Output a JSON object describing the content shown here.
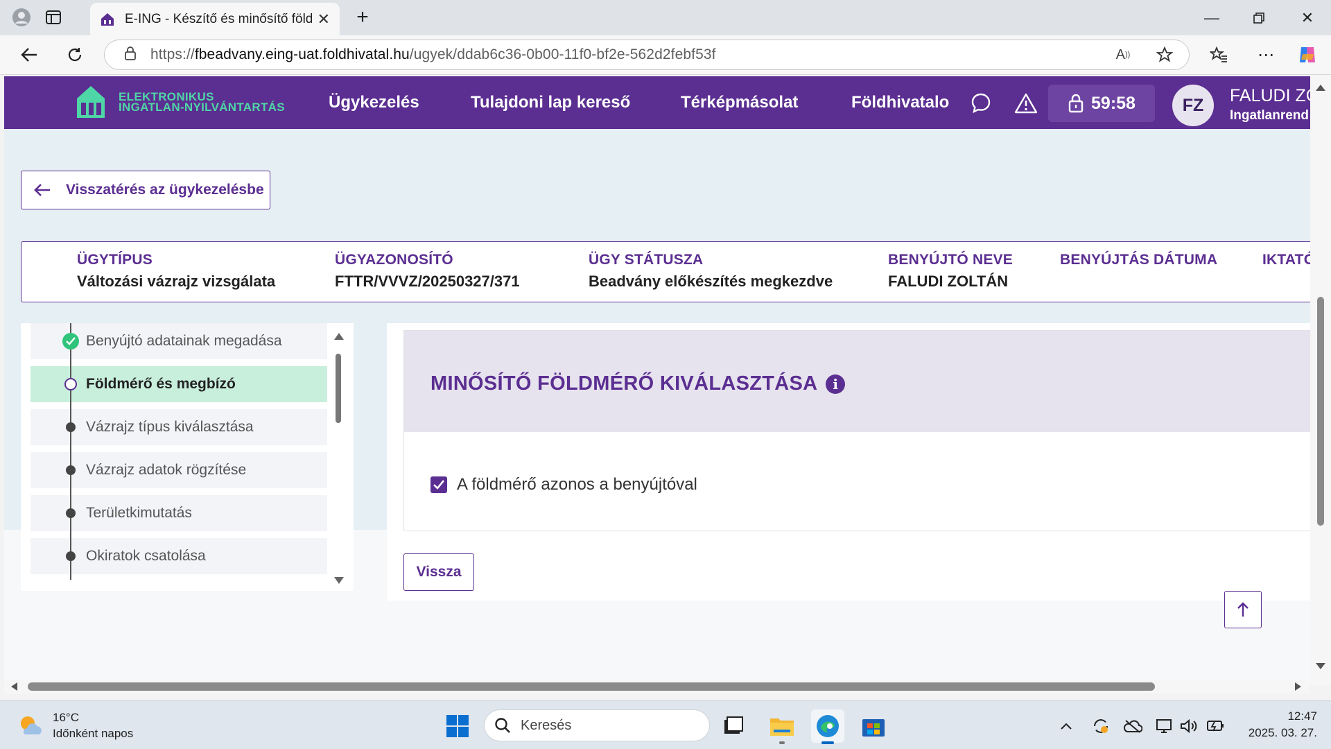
{
  "browser": {
    "tab_title": "E-ING - Készítő és minősítő földm",
    "url_prefix": "https://",
    "url_host": "fbeadvany.eing-uat.foldhivatal.hu",
    "url_path": "/ugyek/ddab6c36-0b00-11f0-bf2e-562d2febf53f"
  },
  "header": {
    "logo_line1": "ELEKTRONIKUS",
    "logo_line2": "INGATLAN-NYILVÁNTARTÁS",
    "menu": [
      "Ügykezelés",
      "Tulajdoni lap kereső",
      "Térképmásolat",
      "Földhivatalo"
    ],
    "timer": "59:58",
    "avatar_initials": "FZ",
    "user_name": "FALUDI ZO",
    "user_role": "Ingatlanrend"
  },
  "back_button": "Visszatérés az ügykezelésbe",
  "case_info": [
    {
      "label": "ÜGYTÍPUS",
      "value": "Változási vázrajz vizsgálata"
    },
    {
      "label": "ÜGYAZONOSÍTÓ",
      "value": "FTTR/VVVZ/20250327/371"
    },
    {
      "label": "ÜGY STÁTUSZA",
      "value": "Beadvány előkészítés megkezdve"
    },
    {
      "label": "BENYÚJTÓ NEVE",
      "value": "FALUDI ZOLTÁN"
    },
    {
      "label": "BENYÚJTÁS DÁTUMA",
      "value": ""
    },
    {
      "label": "IKTATÓ",
      "value": ""
    }
  ],
  "steps": [
    {
      "label": "Benyújtó adatainak megadása",
      "state": "done"
    },
    {
      "label": "Földmérő és megbízó",
      "state": "active"
    },
    {
      "label": "Vázrajz típus kiválasztása",
      "state": "todo"
    },
    {
      "label": "Vázrajz adatok rögzítése",
      "state": "todo"
    },
    {
      "label": "Területkimutatás",
      "state": "todo"
    },
    {
      "label": "Okiratok csatolása",
      "state": "todo"
    }
  ],
  "section": {
    "title": "MINŐSÍTŐ FÖLDMÉRŐ KIVÁLASZTÁSA",
    "info_icon": "i",
    "checkbox_label": "A földmérő azonos a benyújtóval",
    "checkbox_checked": true
  },
  "vissza_button": "Vissza",
  "taskbar": {
    "weather_temp": "16°C",
    "weather_desc": "Időnként napos",
    "search_placeholder": "Keresés",
    "time": "12:47",
    "date": "2025. 03. 27."
  },
  "colors": {
    "brand_purple": "#5b2e91",
    "accent_green": "#4fd6a6",
    "active_step": "#c8eedc"
  }
}
